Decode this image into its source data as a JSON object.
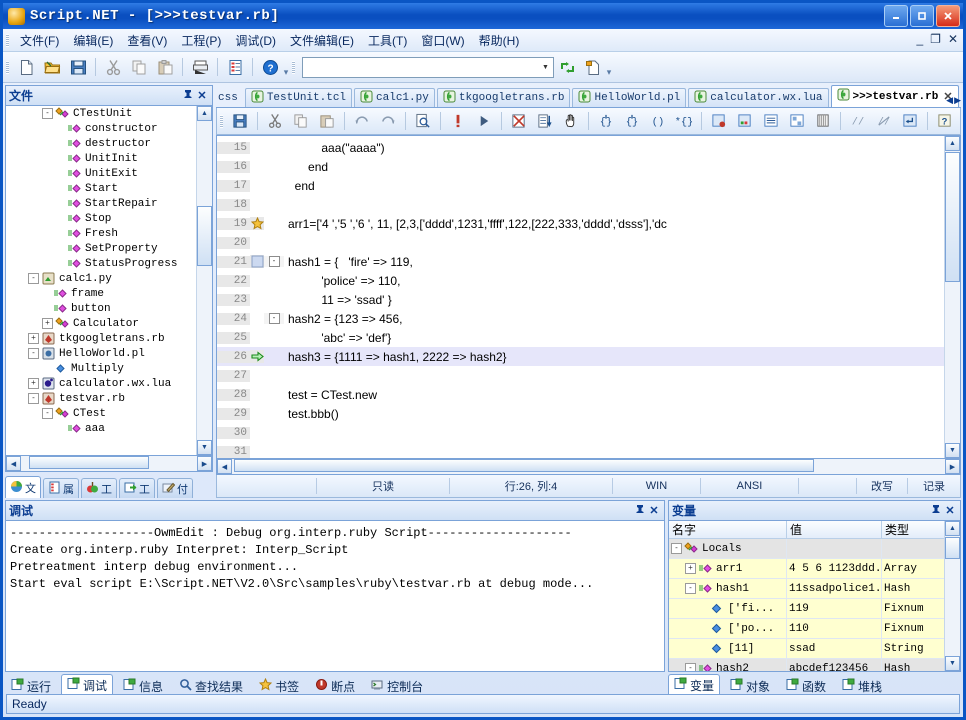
{
  "window": {
    "title": "Script.NET - [>>>testvar.rb]",
    "minimize": "_",
    "maximize": "□",
    "close": "✕",
    "mdi_minimize": "_",
    "mdi_restore": "❐",
    "mdi_close": "✕"
  },
  "menu": [
    {
      "label": "文件(F)"
    },
    {
      "label": "编辑(E)"
    },
    {
      "label": "查看(V)"
    },
    {
      "label": "工程(P)"
    },
    {
      "label": "调试(D)"
    },
    {
      "label": "文件编辑(E)"
    },
    {
      "label": "工具(T)"
    },
    {
      "label": "窗口(W)"
    },
    {
      "label": "帮助(H)"
    }
  ],
  "toolbar": {
    "icons": [
      "new-file-icon",
      "open-folder-icon",
      "save-icon",
      "cut-icon",
      "copy-icon",
      "paste-icon",
      "print-icon",
      "properties-icon",
      "help-icon"
    ],
    "combo_value": "",
    "combo_placeholder": "",
    "run_icon": "refresh-icon",
    "newproject_icon": "new-project-icon"
  },
  "filetree": {
    "title": "文件",
    "pin": "中",
    "close": "✕",
    "rows": [
      {
        "indent": 2,
        "expander": "-",
        "icon": "class-icon",
        "label": "CTestUnit"
      },
      {
        "indent": 3,
        "expander": "",
        "icon": "method-icon",
        "label": "constructor"
      },
      {
        "indent": 3,
        "expander": "",
        "icon": "method-icon",
        "label": "destructor"
      },
      {
        "indent": 3,
        "expander": "",
        "icon": "method-icon",
        "label": "UnitInit"
      },
      {
        "indent": 3,
        "expander": "",
        "icon": "method-icon",
        "label": "UnitExit"
      },
      {
        "indent": 3,
        "expander": "",
        "icon": "method-icon",
        "label": "Start"
      },
      {
        "indent": 3,
        "expander": "",
        "icon": "method-icon",
        "label": "StartRepair"
      },
      {
        "indent": 3,
        "expander": "",
        "icon": "method-icon",
        "label": "Stop"
      },
      {
        "indent": 3,
        "expander": "",
        "icon": "method-icon",
        "label": "Fresh"
      },
      {
        "indent": 3,
        "expander": "",
        "icon": "method-icon",
        "label": "SetProperty"
      },
      {
        "indent": 3,
        "expander": "",
        "icon": "method-icon",
        "label": "StatusProgress"
      },
      {
        "indent": 1,
        "expander": "-",
        "icon": "python-file-icon",
        "label": "calc1.py"
      },
      {
        "indent": 2,
        "expander": "",
        "icon": "method-icon",
        "label": "frame"
      },
      {
        "indent": 2,
        "expander": "",
        "icon": "method-icon",
        "label": "button"
      },
      {
        "indent": 2,
        "expander": "+",
        "icon": "class-icon",
        "label": "Calculator"
      },
      {
        "indent": 1,
        "expander": "+",
        "icon": "ruby-file-icon",
        "label": "tkgoogletrans.rb"
      },
      {
        "indent": 1,
        "expander": "-",
        "icon": "perl-file-icon",
        "label": "HelloWorld.pl"
      },
      {
        "indent": 2,
        "expander": "",
        "icon": "function-icon",
        "label": "Multiply"
      },
      {
        "indent": 1,
        "expander": "+",
        "icon": "lua-file-icon",
        "label": "calculator.wx.lua"
      },
      {
        "indent": 1,
        "expander": "-",
        "icon": "ruby-file-icon",
        "label": "testvar.rb"
      },
      {
        "indent": 2,
        "expander": "-",
        "icon": "class-icon",
        "label": "CTest"
      },
      {
        "indent": 3,
        "expander": "",
        "icon": "method-icon",
        "label": "aaa"
      }
    ],
    "tabs": [
      {
        "label": "文",
        "icon": "files-icon",
        "active": true
      },
      {
        "label": "属",
        "icon": "properties-icon",
        "active": false
      },
      {
        "label": "工",
        "icon": "project-icon",
        "active": false
      },
      {
        "label": "工",
        "icon": "tools-icon",
        "active": false
      },
      {
        "label": "付",
        "icon": "notes-icon",
        "active": false
      }
    ]
  },
  "editor": {
    "tabs": [
      {
        "label": "css",
        "icon": "",
        "active": false,
        "clipped": true
      },
      {
        "label": "TestUnit.tcl",
        "icon": "script-icon",
        "active": false
      },
      {
        "label": "calc1.py",
        "icon": "script-icon",
        "active": false
      },
      {
        "label": "tkgoogletrans.rb",
        "icon": "script-icon",
        "active": false
      },
      {
        "label": "HelloWorld.pl",
        "icon": "script-icon",
        "active": false
      },
      {
        "label": "calculator.wx.lua",
        "icon": "script-icon",
        "active": false
      },
      {
        "label": ">>>testvar.rb",
        "icon": "script-icon",
        "active": true,
        "close": "✕"
      }
    ],
    "nav_prev": "◀",
    "nav_next": "▶",
    "toolbar_icons": [
      "save-icon",
      "cut-icon",
      "copy-icon",
      "paste-icon",
      "undo-icon",
      "redo-icon",
      "find-icon",
      "stop-icon",
      "run-icon",
      "debug-stop-icon",
      "step-over-icon",
      "hand-icon",
      "step-into-icon",
      "step-out-icon",
      "step-return-icon",
      "run-to-cursor-icon",
      "breakpoint-icon",
      "watch-icon",
      "list-icon",
      "callstack-icon",
      "memory-icon",
      "comment-icon",
      "uncomment-icon",
      "indent-icon",
      "help-icon"
    ],
    "lines": [
      {
        "num": "15",
        "marker": "",
        "fold": "",
        "text": "          aaa(\"aaaa\")",
        "current": false
      },
      {
        "num": "16",
        "marker": "",
        "fold": "",
        "text": "      end",
        "current": false
      },
      {
        "num": "17",
        "marker": "",
        "fold": "",
        "text": "  end",
        "current": false
      },
      {
        "num": "18",
        "marker": "",
        "fold": "",
        "text": "",
        "current": false
      },
      {
        "num": "19",
        "marker": "bookmark-star-icon",
        "fold": "",
        "text": "arr1=['4 ','5 ','6 ', 11, [2,3,['dddd',1231,'ffff',122,[222,333,'dddd','dsss'],'dc",
        "current": false
      },
      {
        "num": "20",
        "marker": "",
        "fold": "",
        "text": "",
        "current": false
      },
      {
        "num": "21",
        "marker": "breakpoint-box-icon",
        "fold": "-",
        "text": "hash1 = {   'fire' => 119,",
        "current": false
      },
      {
        "num": "22",
        "marker": "",
        "fold": "",
        "text": "          'police' => 110,",
        "current": false
      },
      {
        "num": "23",
        "marker": "",
        "fold": "",
        "text": "          11 => 'ssad' }",
        "current": false
      },
      {
        "num": "24",
        "marker": "",
        "fold": "-",
        "text": "hash2 = {123 => 456,",
        "current": false
      },
      {
        "num": "25",
        "marker": "",
        "fold": "",
        "text": "          'abc' => 'def'}",
        "current": false
      },
      {
        "num": "26",
        "marker": "current-line-arrow-icon",
        "fold": "",
        "text": "hash3 = {1111 => hash1, 2222 => hash2}",
        "current": true
      },
      {
        "num": "27",
        "marker": "",
        "fold": "",
        "text": "",
        "current": false
      },
      {
        "num": "28",
        "marker": "",
        "fold": "",
        "text": "test = CTest.new",
        "current": false
      },
      {
        "num": "29",
        "marker": "",
        "fold": "",
        "text": "test.bbb()",
        "current": false
      },
      {
        "num": "30",
        "marker": "",
        "fold": "",
        "text": "",
        "current": false
      },
      {
        "num": "31",
        "marker": "",
        "fold": "",
        "text": "",
        "current": false
      }
    ],
    "status": {
      "readonly": "只读",
      "position": "行:26, 列:4",
      "lineending": "WIN",
      "encoding": "ANSI",
      "overwrite": "改写",
      "record": "记录"
    }
  },
  "debug": {
    "title": "调试",
    "pin": "中",
    "close": "✕",
    "output": "--------------------OwmEdit : Debug org.interp.ruby Script--------------------\nCreate org.interp.ruby Interpret: Interp_Script\nPretreatment interp debug environment...\nStart eval script E:\\Script.NET\\V2.0\\Src\\samples\\ruby\\testvar.rb at debug mode...",
    "tabs": [
      {
        "label": "运行",
        "icon": "run-tab-icon",
        "active": false
      },
      {
        "label": "调试",
        "icon": "debug-tab-icon",
        "active": true
      },
      {
        "label": "信息",
        "icon": "info-tab-icon",
        "active": false
      },
      {
        "label": "查找结果",
        "icon": "search-result-icon",
        "active": false
      },
      {
        "label": "书签",
        "icon": "bookmark-star-icon",
        "active": false
      },
      {
        "label": "断点",
        "icon": "breakpoint-icon",
        "active": false
      },
      {
        "label": "控制台",
        "icon": "console-icon",
        "active": false
      }
    ]
  },
  "variables": {
    "title": "变量",
    "pin": "中",
    "close": "✕",
    "columns": [
      "名字",
      "值",
      "类型"
    ],
    "rows": [
      {
        "indent": 0,
        "expander": "-",
        "icon": "locals-icon",
        "name": "Locals",
        "value": "",
        "type": "",
        "style": "sel"
      },
      {
        "indent": 1,
        "expander": "+",
        "icon": "variable-icon",
        "name": "arr1",
        "value": "4 5 6 1123ddd...",
        "type": "Array",
        "style": "hl"
      },
      {
        "indent": 1,
        "expander": "-",
        "icon": "variable-icon",
        "name": "hash1",
        "value": "11ssadpolice1...",
        "type": "Hash",
        "style": "hl"
      },
      {
        "indent": 2,
        "expander": "",
        "icon": "value-icon",
        "name": "['fi...",
        "value": "119",
        "type": "Fixnum",
        "style": "hl"
      },
      {
        "indent": 2,
        "expander": "",
        "icon": "value-icon",
        "name": "['po...",
        "value": "110",
        "type": "Fixnum",
        "style": "hl"
      },
      {
        "indent": 2,
        "expander": "",
        "icon": "value-icon",
        "name": "[11]",
        "value": "ssad",
        "type": "String",
        "style": "hl"
      },
      {
        "indent": 1,
        "expander": "-",
        "icon": "variable-icon",
        "name": "hash2",
        "value": "abcdef123456",
        "type": "Hash",
        "style": "sel"
      }
    ],
    "tabs": [
      {
        "label": "变量",
        "icon": "variables-tab-icon",
        "active": true
      },
      {
        "label": "对象",
        "icon": "objects-tab-icon",
        "active": false
      },
      {
        "label": "函数",
        "icon": "functions-tab-icon",
        "active": false
      },
      {
        "label": "堆栈",
        "icon": "stack-tab-icon",
        "active": false
      }
    ]
  },
  "statusbar": {
    "text": "Ready"
  }
}
